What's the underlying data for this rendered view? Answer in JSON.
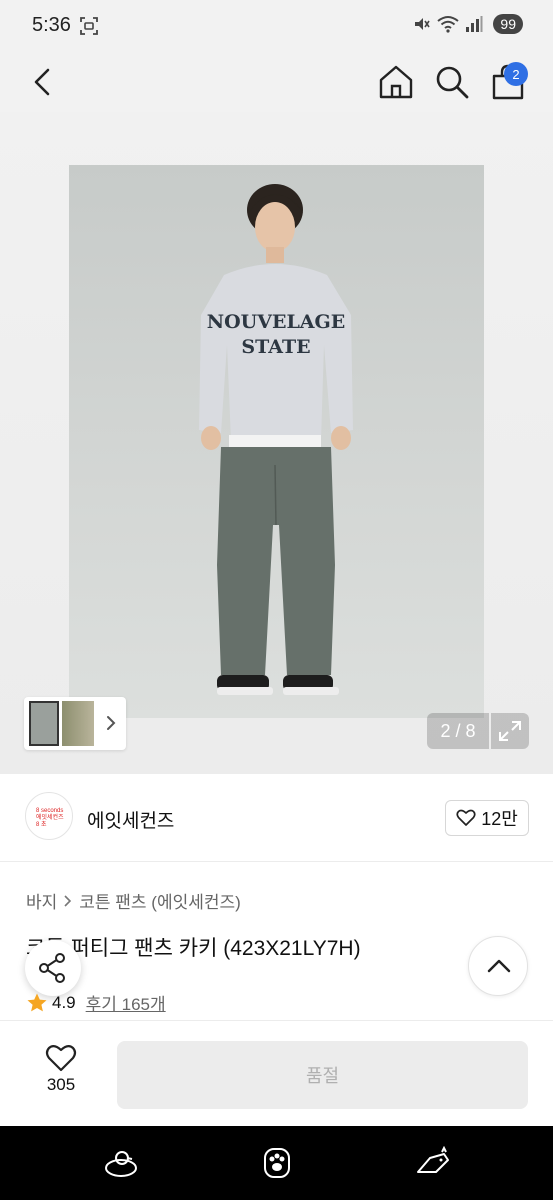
{
  "status_bar": {
    "time": "5:36",
    "battery": "99"
  },
  "header": {
    "icons": [
      "back-icon",
      "home-icon",
      "search-icon",
      "cart-icon"
    ],
    "cart_count": "2"
  },
  "gallery": {
    "counter": "2 / 8",
    "photo_text_line1": "NOUVELAGE",
    "photo_text_line2": "STATE"
  },
  "brand": {
    "logo_line1": "8 seconds",
    "logo_line2": "에잇세컨즈",
    "logo_line3": "8 초",
    "name": "에잇세컨즈",
    "likes": "12만"
  },
  "product": {
    "breadcrumb": [
      "바지",
      "코튼 팬츠 (에잇세컨즈)"
    ],
    "title": "코튼 퍼티그 팬츠 카키 (423X21LY7H)",
    "rating": "4.9",
    "review_label": "후기 165개"
  },
  "purchase": {
    "wish_count": "305",
    "soldout_label": "품절"
  },
  "colors": {
    "accent_blue": "#2f6fe4",
    "star": "#f5a623",
    "soldout_bg": "#ececec"
  }
}
